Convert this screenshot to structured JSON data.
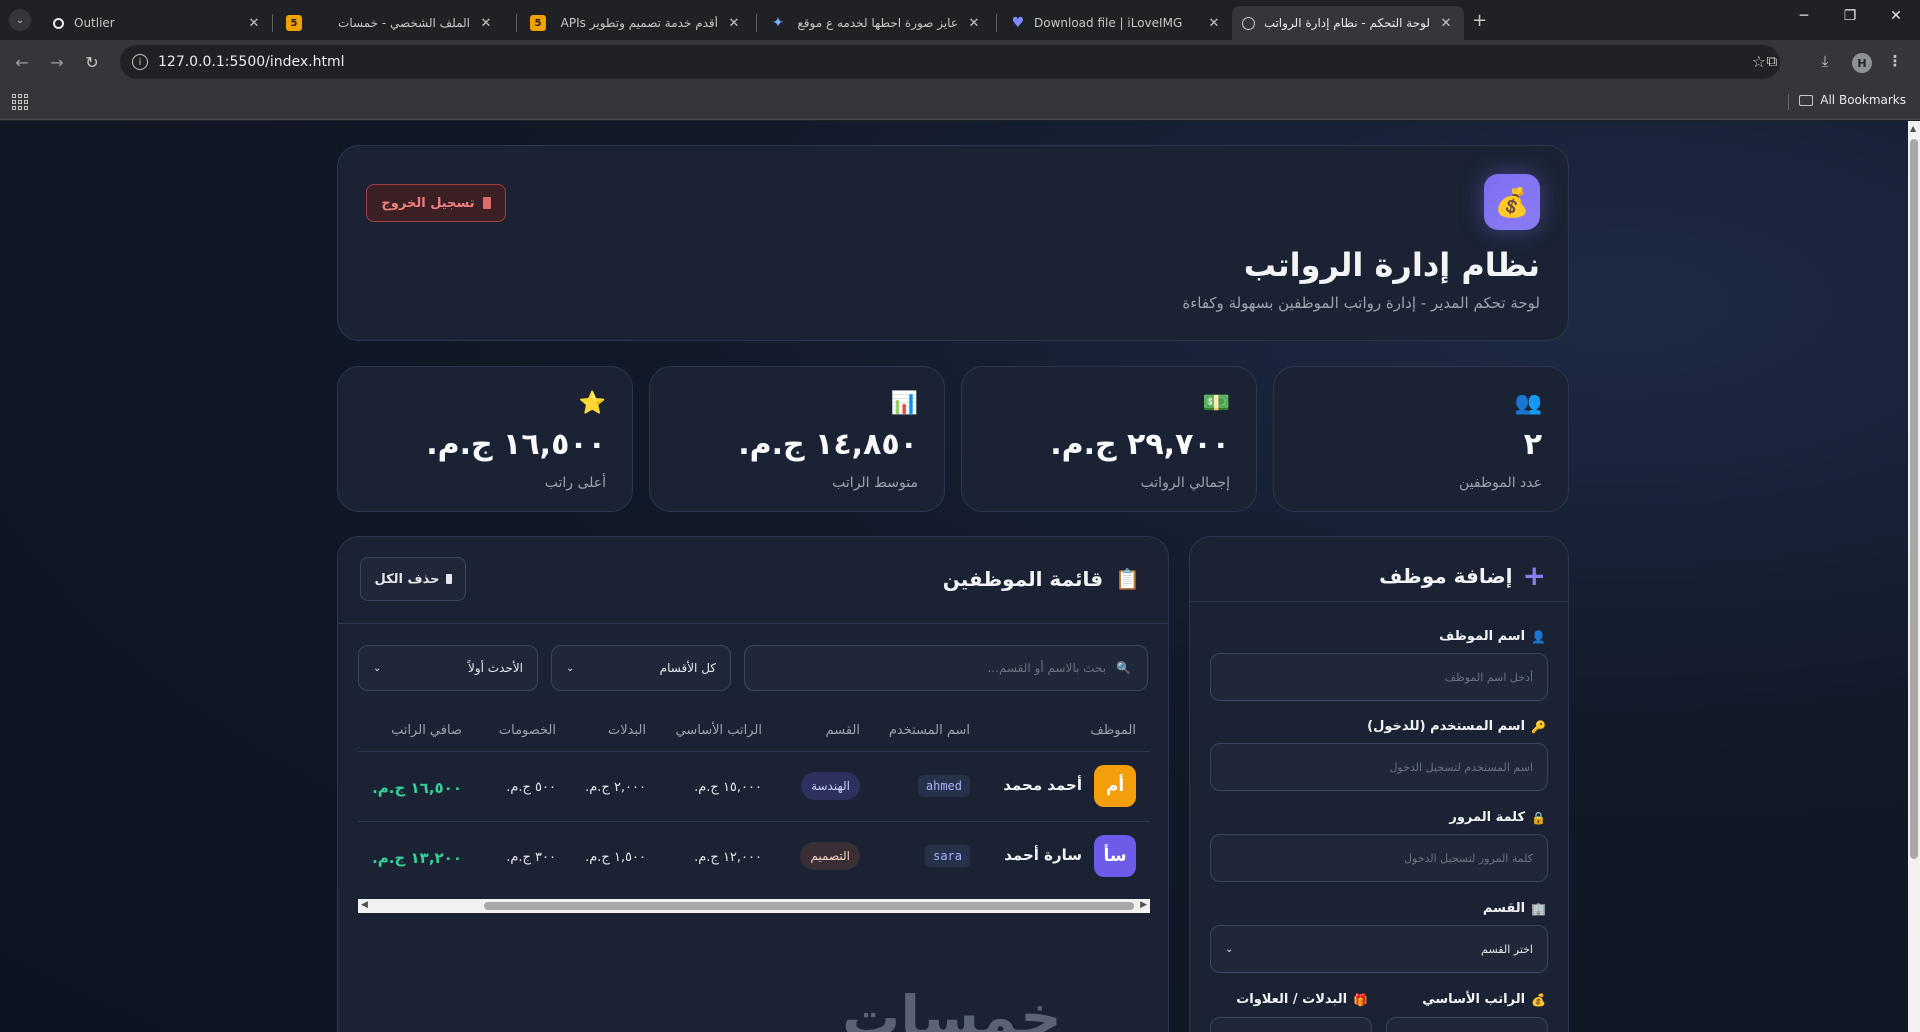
{
  "browser": {
    "tabs": [
      {
        "title": "Outlier",
        "favicon": "circle-o"
      },
      {
        "title": "الملف الشخصي - خمسات",
        "favicon": "5"
      },
      {
        "title": "أقدم خدمة تصميم وتطوير APIs",
        "favicon": "5"
      },
      {
        "title": "عايز صورة احطها لخدمه ع موقع",
        "favicon": "spark"
      },
      {
        "title": "Download file | iLoveIMG",
        "favicon": "heart"
      },
      {
        "title": "لوحة التحكم - نظام إدارة الرواتب",
        "favicon": "globe"
      }
    ],
    "url": "127.0.0.1:5500/index.html",
    "profile_initial": "H",
    "bookmarks_label": "All Bookmarks"
  },
  "header": {
    "logo_icon": "💰",
    "title": "نظام إدارة الرواتب",
    "subtitle": "لوحة تحكم المدير - إدارة رواتب الموظفين بسهولة وكفاءة",
    "logout_label": "تسجيل الخروج"
  },
  "stats": [
    {
      "icon": "👥",
      "value": "٢",
      "label": "عدد الموظفين"
    },
    {
      "icon": "💵",
      "value": "٢٩,٧٠٠ ج.م.",
      "label": "إجمالي الرواتب"
    },
    {
      "icon": "📊",
      "value": "١٤,٨٥٠ ج.م.",
      "label": "متوسط الراتب"
    },
    {
      "icon": "⭐",
      "value": "١٦,٥٠٠ ج.م.",
      "label": "أعلى راتب"
    }
  ],
  "employee_list": {
    "icon": "📋",
    "title": "قائمة الموظفين",
    "delete_all_label": "حذف الكل",
    "search_placeholder": "بحث بالاسم أو القسم...",
    "dept_filter": "كل الأقسام",
    "sort": "الأحدث أولاً",
    "columns": [
      "الموظف",
      "اسم المستخدم",
      "القسم",
      "الراتب الأساسي",
      "البدلات",
      "الخصومات",
      "صافي الراتب"
    ],
    "rows": [
      {
        "initials": "أم",
        "avatar_color": "#f59e0b",
        "name": "أحمد محمد",
        "username": "ahmed",
        "dept": "الهندسة",
        "dept_bg": "#2e3160",
        "dept_fg": "#c7d2fe",
        "base": "١٥,٠٠٠ ج.م.",
        "allow": "٢,٠٠٠ ج.م.",
        "deduct": "٥٠٠ ج.م.",
        "net": "١٦,٥٠٠ ج.م."
      },
      {
        "initials": "سأ",
        "avatar_color": "#6d5ce7",
        "name": "سارة أحمد",
        "username": "sara",
        "dept": "التصميم",
        "dept_bg": "#3a2e35",
        "dept_fg": "#f5d0c5",
        "base": "١٢,٠٠٠ ج.م.",
        "allow": "١,٥٠٠ ج.م.",
        "deduct": "٣٠٠ ج.م.",
        "net": "١٣,٢٠٠ ج.م."
      }
    ],
    "watermark": "خمسات"
  },
  "add_form": {
    "title": "إضافة موظف",
    "fields": [
      {
        "label": "اسم الموظف",
        "icon": "👤",
        "placeholder": "أدخل اسم الموظف"
      },
      {
        "label": "اسم المستخدم (للدخول)",
        "icon": "🔑",
        "placeholder": "اسم المستخدم لتسجيل الدخول"
      },
      {
        "label": "كلمة المرور",
        "icon": "🔒",
        "placeholder": "كلمة المرور لتسجيل الدخول"
      },
      {
        "label": "القسم",
        "icon": "🏢",
        "placeholder": "اختر القسم"
      }
    ],
    "base_salary_label": "الراتب الأساسي",
    "base_salary_icon": "💰",
    "allowances_label": "البدلات / العلاوات",
    "allowances_icon": "🎁"
  },
  "colors": {
    "accent": "#8b7cf6",
    "success": "#34d399",
    "danger": "#f08080",
    "background": "#111827"
  }
}
